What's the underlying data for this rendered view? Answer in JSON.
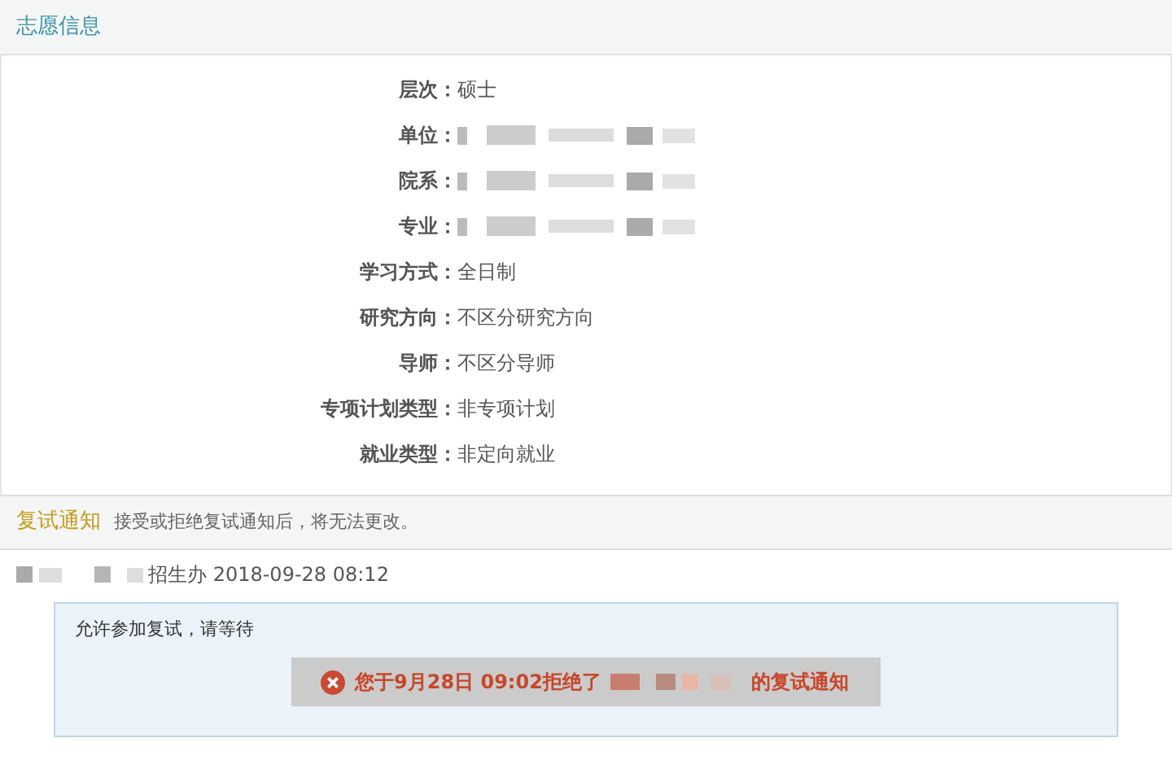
{
  "section_1": {
    "title": "志愿信息",
    "fields": [
      {
        "label": "层次：",
        "kind": "text",
        "value": "硕士"
      },
      {
        "label": "单位：",
        "kind": "redacted"
      },
      {
        "label": "院系：",
        "kind": "redacted"
      },
      {
        "label": "专业：",
        "kind": "redacted"
      },
      {
        "label": "学习方式：",
        "kind": "text",
        "value": "全日制"
      },
      {
        "label": "研究方向：",
        "kind": "text",
        "value": "不区分研究方向"
      },
      {
        "label": "导师：",
        "kind": "text",
        "value": "不区分导师"
      },
      {
        "label": "专项计划类型：",
        "kind": "text",
        "value": "非专项计划"
      },
      {
        "label": "就业类型：",
        "kind": "text",
        "value": "非定向就业"
      }
    ]
  },
  "section_2": {
    "title": "复试通知",
    "hint": "接受或拒绝复试通知后，将无法更改。",
    "message": {
      "sender": "招生办",
      "time": "2018-09-28 08:12",
      "body": "允许参加复试，请等待"
    },
    "toast": {
      "before": "您于9月28日 09:02拒绝了",
      "after": "的复试通知"
    }
  }
}
